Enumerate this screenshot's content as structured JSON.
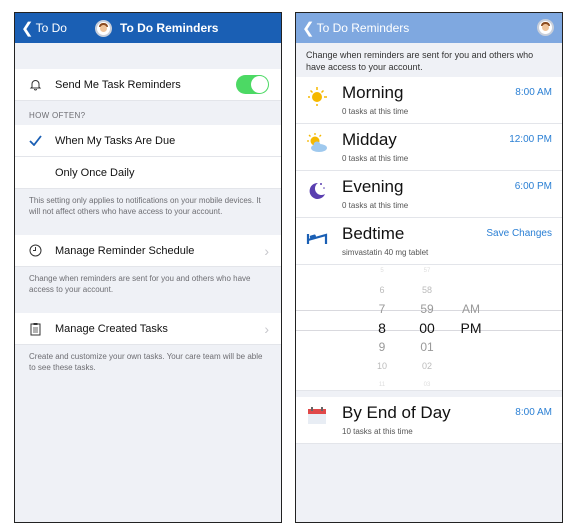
{
  "left": {
    "back_label": "To Do",
    "title": "To Do Reminders",
    "reminder_toggle_label": "Send Me Task Reminders",
    "reminder_toggle_on": true,
    "how_often_label": "HOW OFTEN?",
    "options": [
      {
        "label": "When My Tasks Are Due",
        "selected": true
      },
      {
        "label": "Only Once Daily",
        "selected": false
      }
    ],
    "setting_note": "This setting only applies to notifications on your mobile devices. It will not affect others who have access to your account.",
    "manage_schedule_label": "Manage Reminder Schedule",
    "manage_schedule_note": "Change when reminders are sent for you and others who have access to your account.",
    "manage_tasks_label": "Manage Created Tasks",
    "manage_tasks_note": "Create and customize your own tasks. Your care team will be able to see these tasks."
  },
  "right": {
    "back_label": "To Do Reminders",
    "intro": "Change when reminders are sent for you and others who have access to your account.",
    "slots": [
      {
        "name": "Morning",
        "time": "8:00 AM",
        "sub": "0 tasks at this time",
        "icon": "sun-icon"
      },
      {
        "name": "Midday",
        "time": "12:00 PM",
        "sub": "0 tasks at this time",
        "icon": "sun-cloud-icon"
      },
      {
        "name": "Evening",
        "time": "6:00 PM",
        "sub": "0 tasks at this time",
        "icon": "moon-icon"
      }
    ],
    "bedtime": {
      "name": "Bedtime",
      "action": "Save Changes",
      "sub": "simvastatin 40 mg tablet",
      "icon": "bed-icon"
    },
    "picker": {
      "hours": [
        "5",
        "6",
        "7",
        "8",
        "9",
        "10",
        "11"
      ],
      "minutes": [
        "57",
        "58",
        "59",
        "00",
        "01",
        "02",
        "03"
      ],
      "ampm": [
        "AM",
        "PM"
      ]
    },
    "end_of_day": {
      "name": "By End of Day",
      "time": "8:00 AM",
      "sub": "10 tasks at this time",
      "icon": "calendar-icon"
    }
  },
  "colors": {
    "nav_dark": "#1a5fb4",
    "nav_light": "#7fa8e0",
    "accent_blue": "#2a7fd4",
    "toggle_green": "#4cd964"
  }
}
